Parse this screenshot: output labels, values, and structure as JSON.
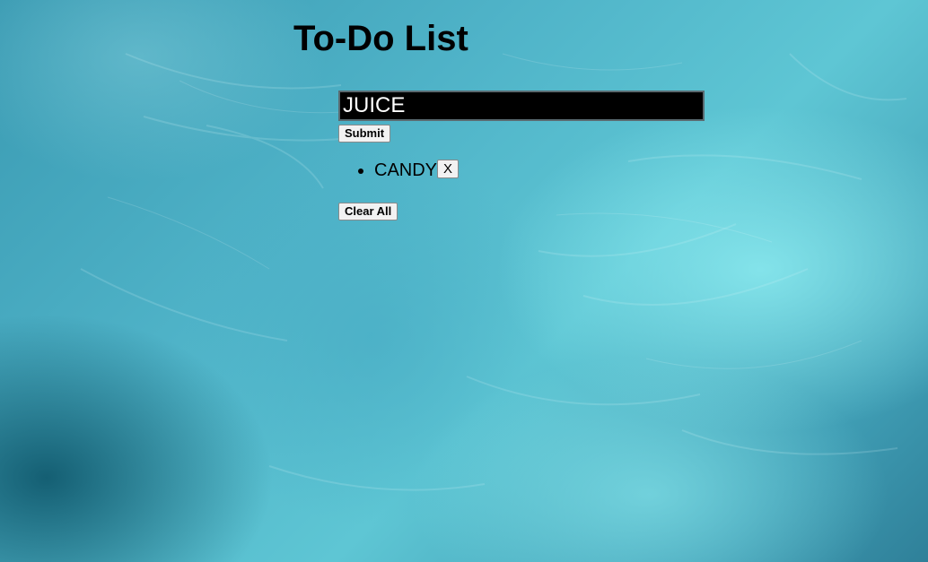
{
  "header": {
    "title": "To-Do List"
  },
  "form": {
    "input_value": "JUICE",
    "submit_label": "Submit"
  },
  "todos": [
    {
      "text": "CANDY",
      "remove_label": "X"
    }
  ],
  "actions": {
    "clear_all_label": "Clear All"
  },
  "colors": {
    "background_primary": "#4fb3c8",
    "background_highlight": "#8cebf0",
    "input_background": "#000000",
    "input_text": "#ffffff"
  }
}
